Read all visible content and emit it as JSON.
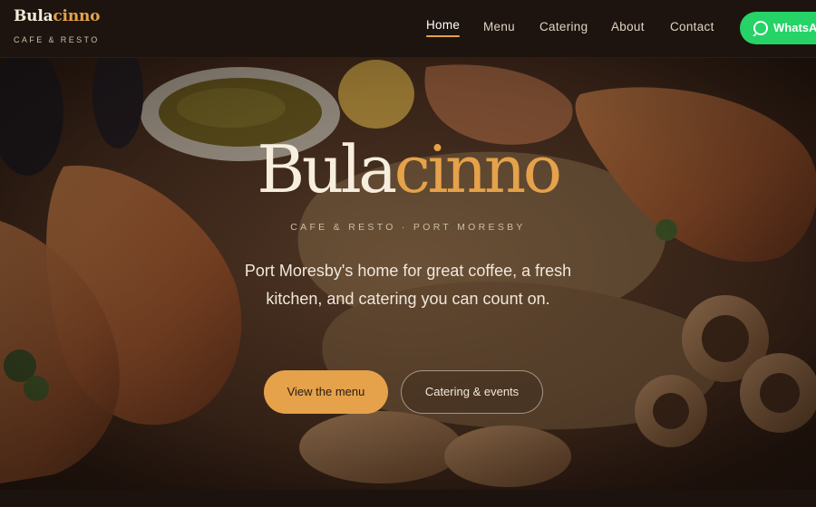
{
  "brand": {
    "name_part1": "Bula",
    "name_part2": "cinno",
    "tagline": "CAFE & RESTO"
  },
  "nav": {
    "links": [
      {
        "label": "Home",
        "active": true
      },
      {
        "label": "Menu",
        "active": false
      },
      {
        "label": "Catering",
        "active": false
      },
      {
        "label": "About",
        "active": false
      },
      {
        "label": "Contact",
        "active": false
      }
    ],
    "whatsapp_label": "WhatsApp"
  },
  "hero": {
    "title_part1": "Bula",
    "title_part2": "cinno",
    "subtitle": "CAFE & RESTO · PORT MORESBY",
    "text": "Port Moresby's home for great coffee, a fresh kitchen, and catering you can count on.",
    "primary_button": "View the menu",
    "secondary_button": "Catering & events"
  },
  "colors": {
    "accent": "#e5a24a",
    "nav_bg": "#1d140f",
    "whatsapp": "#25d366",
    "cream": "#f7eedd"
  },
  "icons": {
    "whatsapp": "whatsapp-icon"
  }
}
